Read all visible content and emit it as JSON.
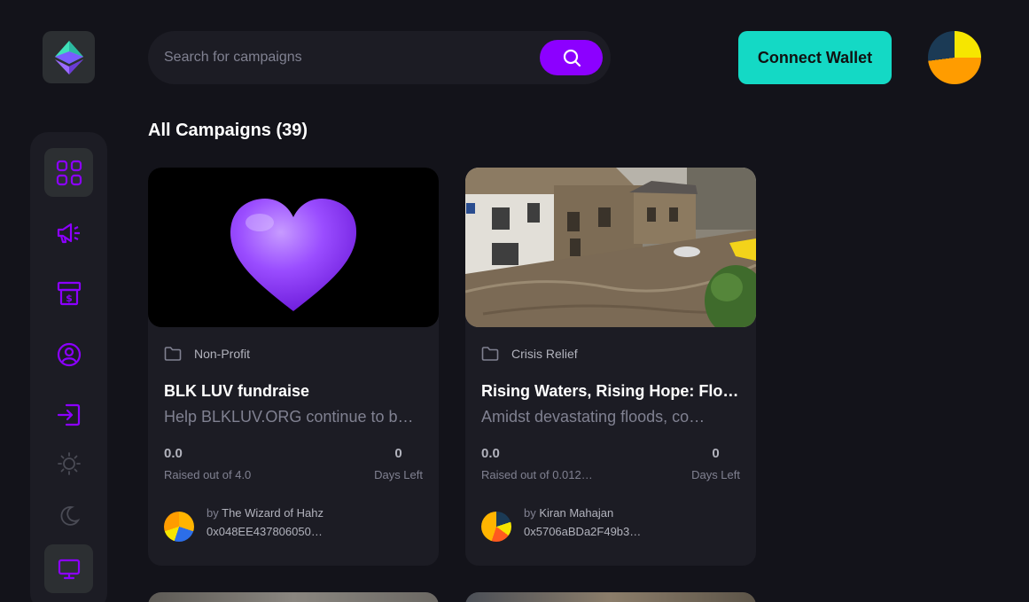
{
  "search": {
    "placeholder": "Search for campaigns"
  },
  "header": {
    "connect_label": "Connect Wallet"
  },
  "main": {
    "heading": "All Campaigns (39)"
  },
  "campaigns": [
    {
      "category": "Non-Profit",
      "title": "BLK LUV fundraise",
      "description": "Help BLKLUV.ORG continue to b…",
      "raised": "0.0",
      "raised_label": "Raised out of 4.0",
      "days": "0",
      "days_label": "Days Left",
      "owner_prefix": "by",
      "owner_name": "The Wizard of Hahz",
      "owner_address": "0x048EE437806050…"
    },
    {
      "category": "Crisis Relief",
      "title": "Rising Waters, Rising Hope: Flo…",
      "description": "Amidst devastating floods, co…",
      "raised": "0.0",
      "raised_label": "Raised out of 0.012…",
      "days": "0",
      "days_label": "Days Left",
      "owner_prefix": "by",
      "owner_name": "Kiran Mahajan",
      "owner_address": "0x5706aBDa2F49b3…"
    }
  ],
  "colors": {
    "accent": "#8c00ff",
    "connect_button": "#14d9c5",
    "background": "#13131a",
    "card": "#1c1c24"
  },
  "icons": {
    "sidebar": [
      "dashboard-icon",
      "campaign-megaphone-icon",
      "payment-icon",
      "profile-icon",
      "logout-icon",
      "sun-icon",
      "moon-icon",
      "monitor-icon"
    ]
  }
}
